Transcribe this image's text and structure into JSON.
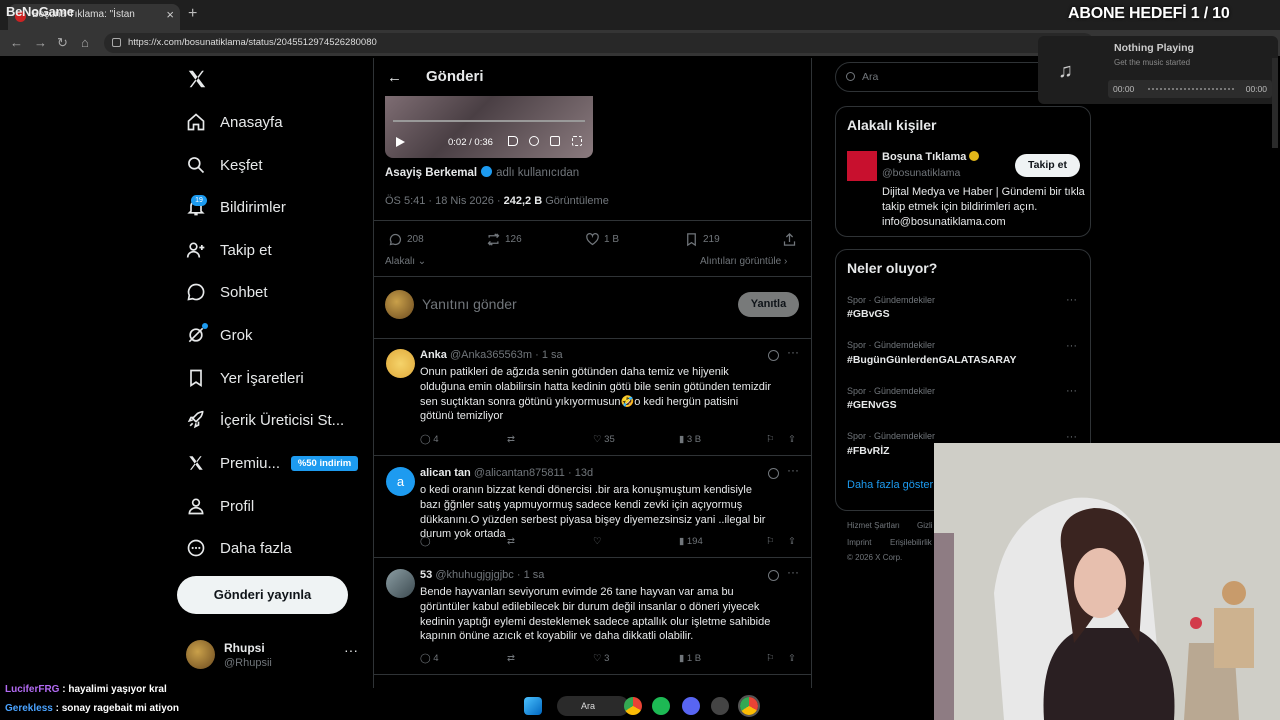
{
  "browser": {
    "tab_title": "Boşuna Tıklama: \"İstan",
    "url": "https://x.com/bosunatiklama/status/2045512974526280080"
  },
  "overlay_logo": "BeNoGame",
  "nav": {
    "items": [
      {
        "label": "Anasayfa",
        "icon": "home-icon"
      },
      {
        "label": "Keşfet",
        "icon": "search-icon"
      },
      {
        "label": "Bildirimler",
        "icon": "bell-icon",
        "badge": "19"
      },
      {
        "label": "Takip et",
        "icon": "follow-icon"
      },
      {
        "label": "Sohbet",
        "icon": "chat-icon"
      },
      {
        "label": "Grok",
        "icon": "grok-icon"
      },
      {
        "label": "Yer İşaretleri",
        "icon": "bookmark-icon"
      },
      {
        "label": "İçerik Üreticisi St...",
        "icon": "rocket-icon"
      },
      {
        "label": "Premiu...",
        "icon": "x-icon",
        "badge": "%50 indirim"
      },
      {
        "label": "Profil",
        "icon": "user-icon"
      },
      {
        "label": "Daha fazla",
        "icon": "more-circle-icon"
      }
    ],
    "post_button": "Gönderi yayınla",
    "profile": {
      "name": "Rhupsi",
      "handle": "@Rhupsii"
    }
  },
  "post": {
    "header": "Gönderi",
    "video_time": "0:02 / 0:36",
    "author": "Asayiş Berkemal",
    "author_suffix": "adlı kullanıcıdan",
    "time": "ÖS 5:41 · 18 Nis 2026 ·",
    "views": "242,2 B",
    "views_label": "Görüntüleme",
    "stats": {
      "replies": "208",
      "reposts": "126",
      "likes": "1 B",
      "bookmarks": "219"
    },
    "relevant": "Alakalı",
    "quotes": "Alıntıları görüntüle",
    "reply_placeholder": "Yanıtını gönder",
    "reply_button": "Yanıtla"
  },
  "replies": [
    {
      "name": "Anka",
      "handle": "@Anka365563m",
      "age": "1 sa",
      "text": "Onun patikleri de ağzıda senin götünden daha temiz ve hijyenik olduğuna emin olabilirsin hatta kedinin götü bile senin götünden temizdir sen suçtıktan sonra götünü yıkıyormusun🤣o kedi hergün patisini götünü temizliyor",
      "replies": "4",
      "reposts": "",
      "likes": "35",
      "views": "3 B"
    },
    {
      "name": "alican tan",
      "handle": "@alicantan875811",
      "age": "13d",
      "text": "o kedi oranın bizzat kendi dönercisi .bir ara konuşmuştum kendisiyle bazı ğğnler satış yapmuyormuş sadece kendi zevki için açıyormuş dükkanını.O yüzden serbest piyasa bişey diyemezsinsiz yani ..ilegal bir durum yok ortada",
      "replies": "",
      "reposts": "",
      "likes": "",
      "views": "194"
    },
    {
      "name": "53",
      "handle": "@khuhugjgjgjbc",
      "age": "1 sa",
      "text": "Bende hayvanları seviyorum evimde 26 tane hayvan var ama bu görüntüler kabul edilebilecek bir durum değil insanlar o döneri yiyecek kedinin yaptığı eylemi desteklemek sadece aptallık olur işletme sahibide kapının önüne azıcık et koyabilir ve daha dikkatli olabilir.",
      "replies": "4",
      "reposts": "",
      "likes": "3",
      "views": "1 B"
    }
  ],
  "right": {
    "search_placeholder": "Ara",
    "people_title": "Alakalı kişiler",
    "person": {
      "name": "Boşuna Tıklama",
      "handle": "@bosunatiklama",
      "follow": "Takip et",
      "bio": "Dijital Medya ve Haber | Gündemi bir tıkla takip etmek için bildirimleri açın. info@bosunatiklama.com"
    },
    "trends_title": "Neler oluyor?",
    "trends": [
      {
        "category": "Spor · Gündemdekiler",
        "tag": "#GBvGS"
      },
      {
        "category": "Spor · Gündemdekiler",
        "tag": "#BugünGünlerdenGALATASARAY"
      },
      {
        "category": "Spor · Gündemdekiler",
        "tag": "#GENvGS"
      },
      {
        "category": "Spor · Gündemdekiler",
        "tag": "#FBvRİZ"
      }
    ],
    "show_more": "Daha fazla göster",
    "footer": [
      "Hizmet Şartları",
      "Gizli",
      "Imprint",
      "Erişilebilirlik",
      "© 2026 X Corp."
    ]
  },
  "overlays": {
    "goal": "ABONE HEDEFİ 1 / 10",
    "music_title": "Nothing Playing",
    "music_sub": "Get the music started",
    "music_start": "00:00",
    "music_end": "00:00",
    "chat": [
      {
        "user": "LuciferFRG",
        "msg": ": hayalimi yaşıyor kral"
      },
      {
        "user": "Gerekless",
        "msg": ": sonay ragebait mi atiyon"
      }
    ],
    "taskbar_search": "Ara"
  }
}
